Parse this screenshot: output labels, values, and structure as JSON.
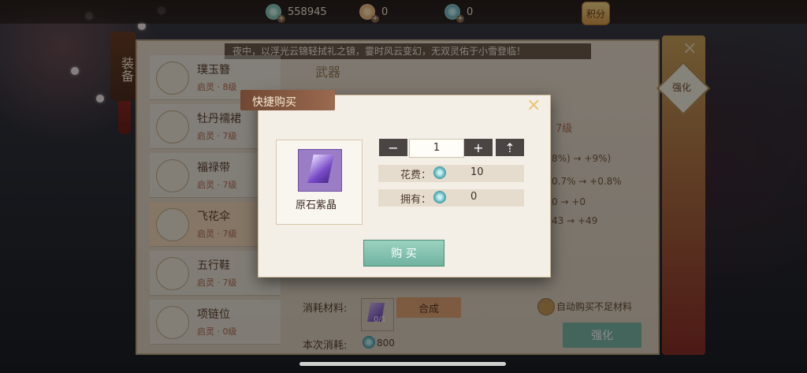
{
  "currencies": [
    {
      "icon": "jade-coin-icon",
      "value": "558945"
    },
    {
      "icon": "gold-coin-icon",
      "value": "0"
    },
    {
      "icon": "teal-coin-icon",
      "value": "0"
    }
  ],
  "top": {
    "score_label": "积分"
  },
  "side_tab": {
    "label": "装备"
  },
  "right_side": {
    "enhance_label": "强化"
  },
  "announcement": "夜中，以浮光云锦轻拭礼之镜，霎时风云变幻，无双灵佑于小雪登临！",
  "equip_list": [
    {
      "name": "璞玉簪",
      "sub": "启灵 · 8级"
    },
    {
      "name": "牡丹襦裙",
      "sub": "启灵 · 7级"
    },
    {
      "name": "福禄带",
      "sub": "启灵 · 7级"
    },
    {
      "name": "飞花伞",
      "sub": "启灵 · 7级"
    },
    {
      "name": "五行鞋",
      "sub": "启灵 · 7级"
    },
    {
      "name": "项链位",
      "sub": "启灵 · 0级"
    }
  ],
  "behind_stats": {
    "weapon_label": "武器",
    "level": "7级",
    "line1": "8%)  →  +9%)",
    "line2": "0.7%  →  +0.8%",
    "line3": "0  →  +0",
    "line4": "43  →  +49"
  },
  "bottom": {
    "consume_label": "消耗材料:",
    "material_count": "0/1",
    "synthesize_label": "合成",
    "auto_buy_label": "自动购买不足材料",
    "this_cost_label": "本次消耗:",
    "this_cost_value": "800",
    "enhance_button": "强化"
  },
  "modal": {
    "title": "快捷购买",
    "item_name": "原石紫晶",
    "quantity": "1",
    "cost_label": "花费：",
    "cost_value": "10",
    "owned_label": "拥有：",
    "owned_value": "0",
    "buy_label": "购 买"
  },
  "colors": {
    "accent": "#7bb9a6",
    "panel": "#f4efe6",
    "title": "#704733"
  }
}
